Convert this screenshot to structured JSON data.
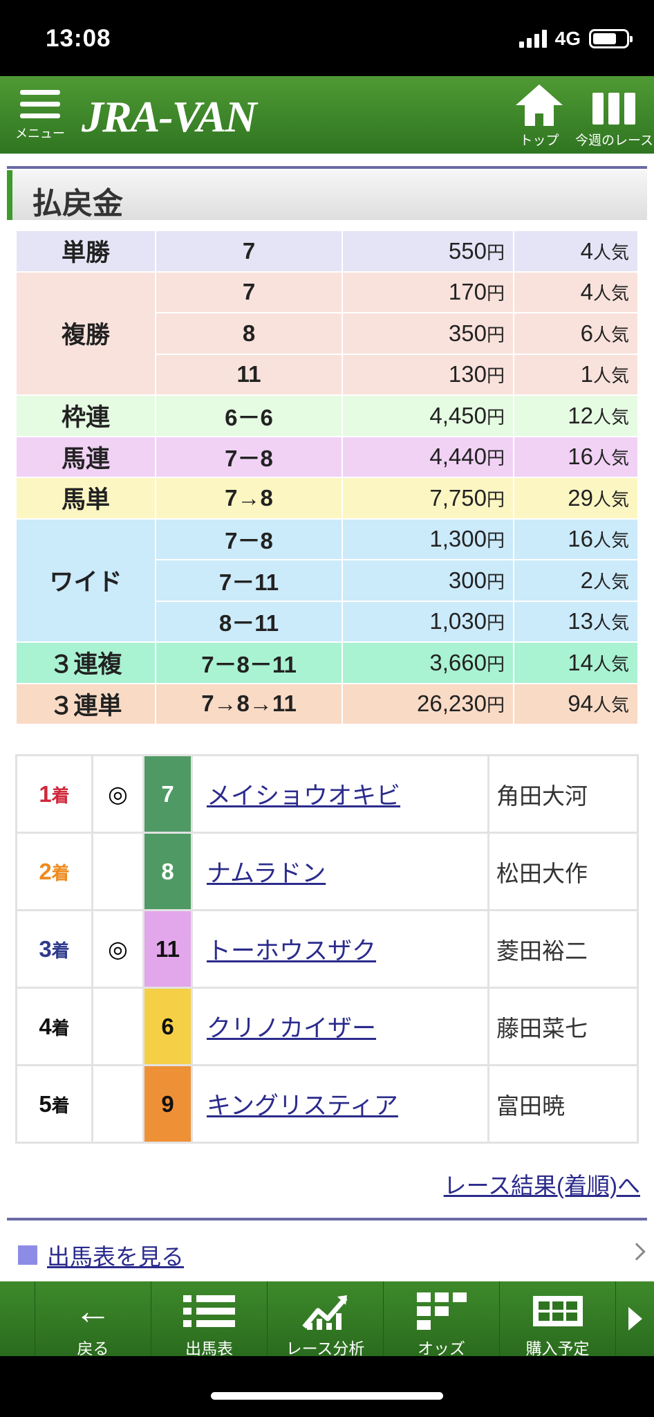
{
  "status_bar": {
    "time": "13:08",
    "network": "4G"
  },
  "header": {
    "menu_label": "メニュー",
    "logo": "JRA-VAN",
    "top_label": "トップ",
    "week_label": "今週のレース"
  },
  "section_title": "払戻金",
  "payout_unit": "円",
  "popularity_unit": "人気",
  "payouts": [
    {
      "bet": "単勝",
      "color": "#e4e4f6",
      "rows": [
        {
          "combo": "7",
          "amount": "550",
          "pop": "4"
        }
      ]
    },
    {
      "bet": "複勝",
      "color": "#f9e2dc",
      "rows": [
        {
          "combo": "7",
          "amount": "170",
          "pop": "4"
        },
        {
          "combo": "8",
          "amount": "350",
          "pop": "6"
        },
        {
          "combo": "11",
          "amount": "130",
          "pop": "1"
        }
      ]
    },
    {
      "bet": "枠連",
      "color": "#e5fbe2",
      "rows": [
        {
          "combo": "6－6",
          "amount": "4,450",
          "pop": "12"
        }
      ]
    },
    {
      "bet": "馬連",
      "color": "#f1d2f5",
      "rows": [
        {
          "combo": "7－8",
          "amount": "4,440",
          "pop": "16"
        }
      ]
    },
    {
      "bet": "馬単",
      "color": "#fcf6c2",
      "rows": [
        {
          "combo": "7→8",
          "amount": "7,750",
          "pop": "29"
        }
      ]
    },
    {
      "bet": "ワイド",
      "color": "#cbeafa",
      "rows": [
        {
          "combo": "7－8",
          "amount": "1,300",
          "pop": "16"
        },
        {
          "combo": "7－11",
          "amount": "300",
          "pop": "2"
        },
        {
          "combo": "8－11",
          "amount": "1,030",
          "pop": "13"
        }
      ]
    },
    {
      "bet": "３連複",
      "color": "#a9f2d2",
      "rows": [
        {
          "combo": "7－8－11",
          "amount": "3,660",
          "pop": "14"
        }
      ]
    },
    {
      "bet": "３連単",
      "color": "#f9dac5",
      "rows": [
        {
          "combo": "7→8→11",
          "amount": "26,230",
          "pop": "94"
        }
      ]
    }
  ],
  "results": [
    {
      "pos": "1",
      "suffix": "着",
      "pos_color": "#d0283c",
      "mark": "◎",
      "num": "7",
      "num_bg": "#4f9a64",
      "num_fg": "#ffffff",
      "horse": "メイショウオキビ",
      "jockey": "角田大河"
    },
    {
      "pos": "2",
      "suffix": "着",
      "pos_color": "#ee8a1c",
      "mark": "",
      "num": "8",
      "num_bg": "#4f9a64",
      "num_fg": "#ffffff",
      "horse": "ナムラドン",
      "jockey": "松田大作"
    },
    {
      "pos": "3",
      "suffix": "着",
      "pos_color": "#2e3a8c",
      "mark": "◎",
      "num": "11",
      "num_bg": "#e2a6ea",
      "num_fg": "#111111",
      "horse": "トーホウスザク",
      "jockey": "菱田裕二"
    },
    {
      "pos": "4",
      "suffix": "着",
      "pos_color": "#111111",
      "mark": "",
      "num": "6",
      "num_bg": "#f5d046",
      "num_fg": "#111111",
      "horse": "クリノカイザー",
      "jockey": "藤田菜七"
    },
    {
      "pos": "5",
      "suffix": "着",
      "pos_color": "#111111",
      "mark": "",
      "num": "9",
      "num_bg": "#ee9036",
      "num_fg": "#111111",
      "horse": "キングリスティア",
      "jockey": "富田暁"
    }
  ],
  "links": {
    "race_results": "レース結果(着順)へ",
    "entries": "出馬表を見る"
  },
  "bottom_nav": [
    {
      "icon": "back-arrow-icon",
      "label": "戻る"
    },
    {
      "icon": "list-icon",
      "label": "出馬表"
    },
    {
      "icon": "chart-icon",
      "label": "レース分析"
    },
    {
      "icon": "grid-icon",
      "label": "オッズ"
    },
    {
      "icon": "ticket-icon",
      "label": "購入予定"
    }
  ]
}
